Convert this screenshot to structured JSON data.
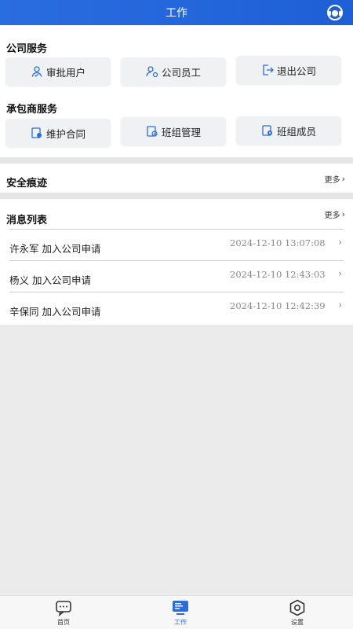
{
  "header": {
    "title": "工作",
    "support_icon": "headset-icon"
  },
  "company_services": {
    "title": "公司服务",
    "buttons": [
      {
        "label": "审批用户",
        "icon": "approve-user-icon"
      },
      {
        "label": "公司员工",
        "icon": "employee-icon"
      },
      {
        "label": "退出公司",
        "icon": "exit-icon"
      }
    ]
  },
  "contractor_services": {
    "title": "承包商服务",
    "buttons": [
      {
        "label": "维护合同",
        "icon": "contract-icon"
      },
      {
        "label": "班组管理",
        "icon": "team-manage-icon"
      },
      {
        "label": "班组成员",
        "icon": "team-member-icon"
      }
    ]
  },
  "safety": {
    "title": "安全痕迹",
    "more": "更多"
  },
  "messages": {
    "title": "消息列表",
    "more": "更多",
    "items": [
      {
        "title": "许永军 加入公司申请",
        "time": "2024-12-10 13:07:08"
      },
      {
        "title": "杨义 加入公司申请",
        "time": "2024-12-10 12:43:03"
      },
      {
        "title": "辛保同 加入公司申请",
        "time": "2024-12-10 12:42:39"
      }
    ]
  },
  "tabbar": {
    "items": [
      {
        "label": "首页",
        "icon": "chat-icon"
      },
      {
        "label": "工作",
        "icon": "monitor-icon"
      },
      {
        "label": "设置",
        "icon": "settings-hex-icon"
      }
    ],
    "active": "工作"
  },
  "colors": {
    "accent": "#2a6de0",
    "background": "#ebebeb"
  }
}
